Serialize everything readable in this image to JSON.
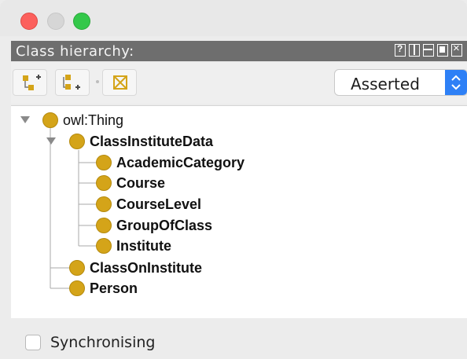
{
  "window": {
    "traffic_lights": [
      "close",
      "minimize",
      "zoom"
    ]
  },
  "view": {
    "title": "Class hierarchy:",
    "header_icons": [
      "help-icon",
      "split-vertical-icon",
      "split-horizontal-icon",
      "maximize-icon",
      "close-icon"
    ]
  },
  "toolbar": {
    "buttons": [
      "add-subclass-icon",
      "add-sibling-class-icon",
      "delete-class-icon"
    ],
    "mode_select": {
      "selected": "Asserted"
    }
  },
  "tree": {
    "root": "owl:Thing",
    "items": [
      {
        "label": "owl:Thing",
        "bold": false,
        "expanded": true
      },
      {
        "label": "ClassInstituteData",
        "bold": true,
        "expanded": true
      },
      {
        "label": "AcademicCategory",
        "bold": true
      },
      {
        "label": "Course",
        "bold": true
      },
      {
        "label": "CourseLevel",
        "bold": true
      },
      {
        "label": "GroupOfClass",
        "bold": true
      },
      {
        "label": "Institute",
        "bold": true
      },
      {
        "label": "ClassOnInstitute",
        "bold": true
      },
      {
        "label": "Person",
        "bold": true
      }
    ]
  },
  "footer": {
    "sync_label": "Synchronising",
    "sync_checked": false
  },
  "colors": {
    "header_bg": "#6e6e6e",
    "class_icon": "#d4a419",
    "select_accent": "#2e80f6"
  }
}
